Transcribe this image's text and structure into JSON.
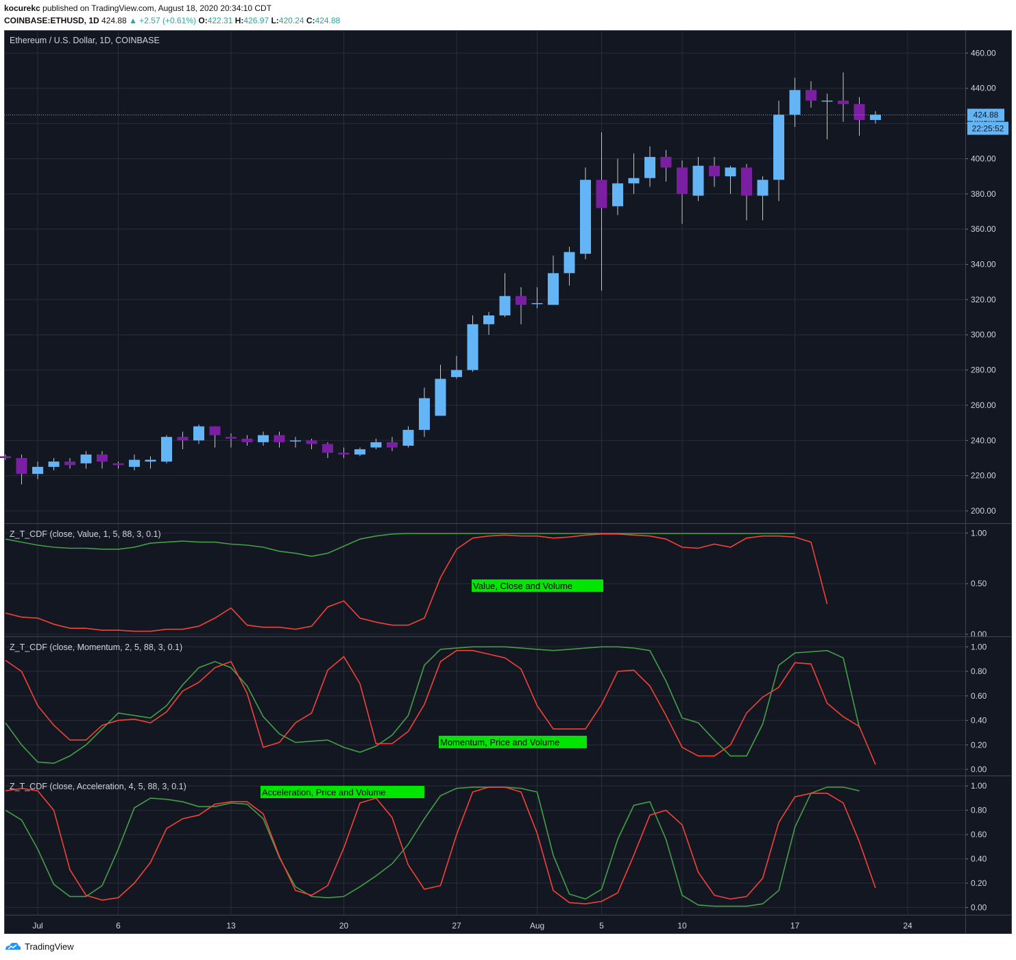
{
  "header": {
    "author": "kocurekc",
    "published": " published on TradingView.com, August 18, 2020 20:34:10 CDT",
    "symbol": "COINBASE:ETHUSD, 1D",
    "last": "424.88",
    "change": "▲ +2.57 (+0.61%)",
    "o_label": "O:",
    "o": "422.31",
    "h_label": "H:",
    "h": "426.97",
    "l_label": "L:",
    "l": "420.24",
    "c_label": "C:",
    "c": "424.88"
  },
  "footer": {
    "brand": "TradingView"
  },
  "colors": {
    "background": "#131722",
    "grid": "#2a2e39",
    "up": "#64b5f6",
    "down": "#7b1fa2",
    "wick": "#c8c8c8",
    "text": "#d1d4dc",
    "green_line": "#43a047",
    "red_line": "#f44336",
    "label_bg": "#00e600",
    "price_tag": "#64b5f6"
  },
  "chart_data": [
    {
      "type": "candlestick",
      "title": "Ethereum / U.S. Dollar, 1D, COINBASE",
      "ylim": [
        193,
        473
      ],
      "y_ticks": [
        200,
        220,
        240,
        260,
        280,
        300,
        320,
        340,
        360,
        380,
        400,
        420,
        440,
        460
      ],
      "y_tick_labels": [
        "200.00",
        "220.00",
        "240.00",
        "260.00",
        "280.00",
        "300.00",
        "320.00",
        "340.00",
        "360.00",
        "380.00",
        "400.00",
        "420.00",
        "440.00",
        "460.00"
      ],
      "x_labels": [
        {
          "day": 2,
          "text": "Jul"
        },
        {
          "day": 7,
          "text": "6"
        },
        {
          "day": 14,
          "text": "13"
        },
        {
          "day": 21,
          "text": "20"
        },
        {
          "day": 28,
          "text": "27"
        },
        {
          "day": 33,
          "text": "Aug"
        },
        {
          "day": 37,
          "text": "5"
        },
        {
          "day": 42,
          "text": "10"
        },
        {
          "day": 49,
          "text": "17"
        },
        {
          "day": 56,
          "text": "24"
        }
      ],
      "last_price": 424.88,
      "last_price_label": "424.88",
      "countdown_label": "22:25:52",
      "candles": [
        [
          231,
          232,
          229,
          230
        ],
        [
          230,
          232,
          215,
          221
        ],
        [
          221,
          228,
          218,
          225
        ],
        [
          225,
          230,
          223,
          228
        ],
        [
          228,
          230,
          224,
          226
        ],
        [
          227,
          234,
          224,
          232
        ],
        [
          232,
          234,
          224,
          228
        ],
        [
          227,
          228,
          224,
          226
        ],
        [
          225,
          232,
          223,
          229
        ],
        [
          228,
          231,
          224,
          229
        ],
        [
          228,
          243,
          227,
          242
        ],
        [
          242,
          245,
          235,
          240
        ],
        [
          240,
          249,
          238,
          248
        ],
        [
          248,
          248,
          236,
          243
        ],
        [
          242,
          244,
          236,
          241
        ],
        [
          241,
          243,
          237,
          239
        ],
        [
          239,
          245,
          237,
          243
        ],
        [
          243,
          245,
          236,
          239
        ],
        [
          240,
          242,
          236,
          240
        ],
        [
          240,
          241,
          235,
          238
        ],
        [
          238,
          239,
          230,
          233
        ],
        [
          233,
          236,
          230,
          232
        ],
        [
          232,
          236,
          231,
          235
        ],
        [
          236,
          241,
          235,
          239
        ],
        [
          239,
          242,
          234,
          236
        ],
        [
          237,
          248,
          236,
          246
        ],
        [
          246,
          270,
          242,
          264
        ],
        [
          254,
          283,
          260,
          275
        ],
        [
          276,
          288,
          275,
          280
        ],
        [
          280,
          311,
          279,
          306
        ],
        [
          306,
          313,
          300,
          311
        ],
        [
          311,
          335,
          310,
          322
        ],
        [
          322,
          327,
          306,
          317
        ],
        [
          318,
          327,
          315,
          318
        ],
        [
          317,
          345,
          317,
          335
        ],
        [
          335,
          350,
          328,
          347
        ],
        [
          346,
          395,
          343,
          388
        ],
        [
          388,
          415,
          325,
          372
        ],
        [
          373,
          400,
          368,
          386
        ],
        [
          386,
          403,
          380,
          389
        ],
        [
          389,
          407,
          384,
          401
        ],
        [
          401,
          405,
          387,
          395
        ],
        [
          395,
          399,
          363,
          380
        ],
        [
          379,
          401,
          376,
          396
        ],
        [
          396,
          401,
          384,
          390
        ],
        [
          390,
          396,
          380,
          395
        ],
        [
          395,
          397,
          365,
          379
        ],
        [
          379,
          390,
          365,
          388
        ],
        [
          388,
          433,
          376,
          425
        ],
        [
          425,
          446,
          418,
          439
        ],
        [
          439,
          444,
          429,
          433
        ],
        [
          433,
          437,
          411,
          433
        ],
        [
          433,
          449,
          421,
          431
        ],
        [
          431,
          435,
          413,
          422
        ],
        [
          422,
          427,
          420,
          425
        ]
      ]
    },
    {
      "type": "line",
      "title": "Z_T_CDF (close, Value, 1, 5, 88, 3, 0.1)",
      "annotation": "Value, Close and Volume",
      "ylim": [
        -0.02,
        1.09
      ],
      "y_ticks": [
        0.0,
        0.5,
        1.0
      ],
      "y_tick_labels": [
        "0.00",
        "0.50",
        "1.00"
      ],
      "series": [
        {
          "color": "green",
          "values": [
            0.94,
            0.91,
            0.88,
            0.86,
            0.85,
            0.85,
            0.84,
            0.84,
            0.86,
            0.9,
            0.91,
            0.92,
            0.91,
            0.91,
            0.89,
            0.88,
            0.86,
            0.82,
            0.8,
            0.77,
            0.8,
            0.87,
            0.94,
            0.97,
            0.99,
            0.995,
            0.995,
            0.995,
            0.995,
            0.995,
            0.995,
            0.995,
            0.995,
            0.995,
            0.995,
            0.995,
            0.995,
            0.995,
            0.995,
            0.995,
            0.995,
            0.995,
            0.995,
            0.995,
            0.995,
            0.995,
            0.995,
            0.995,
            0.995,
            0.995
          ]
        },
        {
          "color": "red",
          "values": [
            0.21,
            0.17,
            0.16,
            0.1,
            0.06,
            0.06,
            0.04,
            0.04,
            0.03,
            0.03,
            0.05,
            0.05,
            0.08,
            0.16,
            0.26,
            0.09,
            0.07,
            0.07,
            0.05,
            0.08,
            0.27,
            0.33,
            0.16,
            0.12,
            0.09,
            0.09,
            0.16,
            0.56,
            0.84,
            0.95,
            0.97,
            0.98,
            0.97,
            0.97,
            0.95,
            0.96,
            0.98,
            0.99,
            0.99,
            0.98,
            0.97,
            0.94,
            0.86,
            0.85,
            0.89,
            0.86,
            0.95,
            0.97,
            0.97,
            0.96,
            0.91,
            0.3
          ]
        }
      ]
    },
    {
      "type": "line",
      "title": "Z_T_CDF (close, Momentum, 2, 5, 88, 3, 0.1)",
      "annotation": "Momentum, Price and Volume",
      "ylim": [
        -0.05,
        1.08
      ],
      "y_ticks": [
        0.0,
        0.2,
        0.4,
        0.6,
        0.8,
        1.0
      ],
      "y_tick_labels": [
        "0.00",
        "0.20",
        "0.40",
        "0.60",
        "0.80",
        "1.00"
      ],
      "series": [
        {
          "color": "green",
          "values": [
            0.38,
            0.2,
            0.06,
            0.05,
            0.11,
            0.2,
            0.33,
            0.46,
            0.44,
            0.42,
            0.52,
            0.69,
            0.83,
            0.88,
            0.83,
            0.68,
            0.43,
            0.29,
            0.22,
            0.23,
            0.24,
            0.18,
            0.14,
            0.19,
            0.28,
            0.44,
            0.85,
            0.98,
            0.99,
            1.0,
            1.0,
            1.0,
            0.99,
            0.98,
            0.97,
            0.98,
            0.99,
            1.0,
            1.0,
            0.99,
            0.97,
            0.72,
            0.42,
            0.38,
            0.24,
            0.11,
            0.11,
            0.37,
            0.85,
            0.95,
            0.96,
            0.97,
            0.91,
            0.34
          ]
        },
        {
          "color": "red",
          "values": [
            0.89,
            0.8,
            0.52,
            0.36,
            0.24,
            0.24,
            0.36,
            0.4,
            0.41,
            0.38,
            0.47,
            0.64,
            0.71,
            0.83,
            0.88,
            0.62,
            0.18,
            0.22,
            0.38,
            0.46,
            0.81,
            0.92,
            0.7,
            0.21,
            0.21,
            0.31,
            0.53,
            0.88,
            0.97,
            0.97,
            0.94,
            0.91,
            0.82,
            0.52,
            0.33,
            0.33,
            0.33,
            0.53,
            0.8,
            0.81,
            0.68,
            0.44,
            0.18,
            0.11,
            0.11,
            0.2,
            0.46,
            0.59,
            0.67,
            0.87,
            0.86,
            0.54,
            0.43,
            0.35,
            0.04
          ]
        }
      ]
    },
    {
      "type": "line",
      "title": "Z_T_CDF (close, Acceleration, 4, 5, 88, 3, 0.1)",
      "annotation": "Acceleration, Price and Volume",
      "ylim": [
        -0.06,
        1.08
      ],
      "y_ticks": [
        0.0,
        0.2,
        0.4,
        0.6,
        0.8,
        1.0
      ],
      "y_tick_labels": [
        "0.00",
        "0.20",
        "0.40",
        "0.60",
        "0.80",
        "1.00"
      ],
      "series": [
        {
          "color": "green",
          "values": [
            0.8,
            0.72,
            0.48,
            0.19,
            0.09,
            0.09,
            0.18,
            0.48,
            0.82,
            0.9,
            0.89,
            0.87,
            0.83,
            0.83,
            0.86,
            0.85,
            0.73,
            0.41,
            0.17,
            0.09,
            0.08,
            0.09,
            0.17,
            0.26,
            0.36,
            0.52,
            0.73,
            0.92,
            0.98,
            0.99,
            0.99,
            0.99,
            0.98,
            0.95,
            0.43,
            0.11,
            0.07,
            0.15,
            0.56,
            0.84,
            0.87,
            0.56,
            0.1,
            0.02,
            0.01,
            0.01,
            0.01,
            0.03,
            0.14,
            0.66,
            0.94,
            0.99,
            0.99,
            0.96
          ]
        },
        {
          "color": "red",
          "values": [
            0.96,
            0.98,
            0.96,
            0.8,
            0.31,
            0.1,
            0.06,
            0.08,
            0.2,
            0.37,
            0.65,
            0.73,
            0.76,
            0.85,
            0.87,
            0.87,
            0.77,
            0.42,
            0.14,
            0.1,
            0.18,
            0.49,
            0.86,
            0.9,
            0.74,
            0.35,
            0.15,
            0.18,
            0.6,
            0.95,
            0.99,
            0.99,
            0.95,
            0.61,
            0.14,
            0.04,
            0.03,
            0.05,
            0.12,
            0.43,
            0.76,
            0.8,
            0.68,
            0.29,
            0.1,
            0.07,
            0.09,
            0.24,
            0.7,
            0.91,
            0.94,
            0.94,
            0.86,
            0.54,
            0.16
          ]
        }
      ]
    }
  ]
}
